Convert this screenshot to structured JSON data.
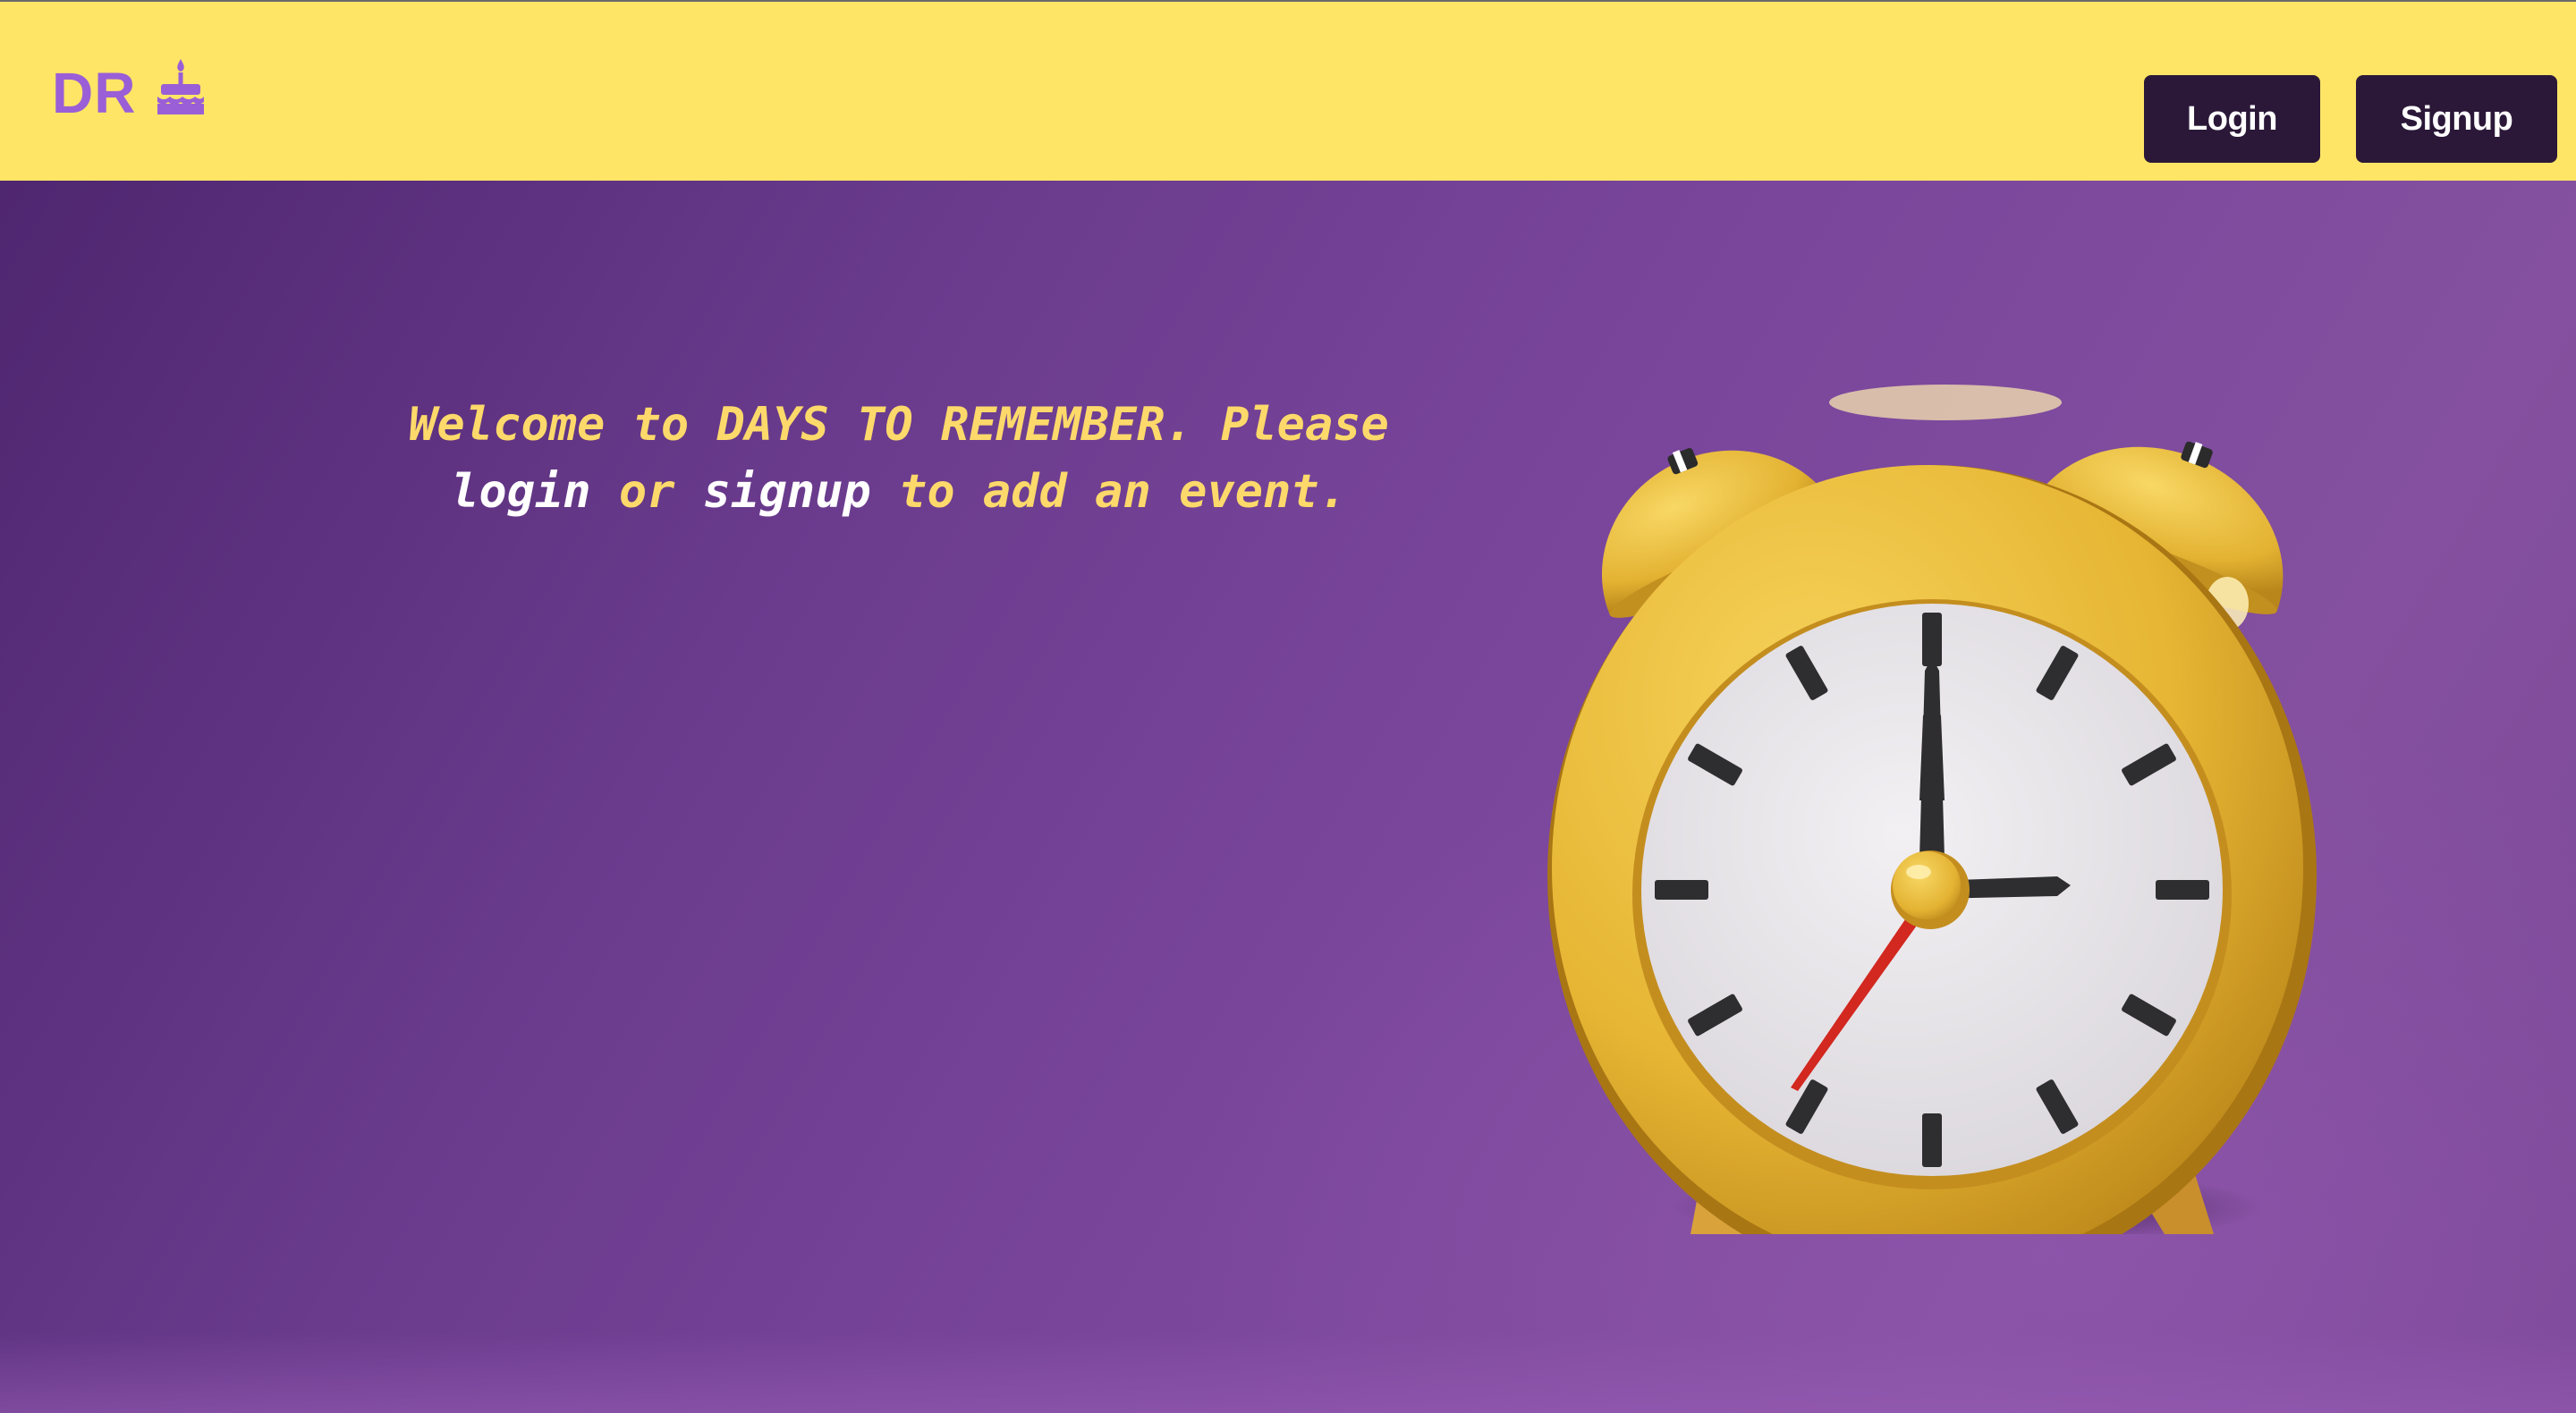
{
  "brand": {
    "text": "DR",
    "icon": "birthday-cake-icon",
    "color": "#9a5fd6"
  },
  "nav": {
    "login_label": "Login",
    "signup_label": "Signup",
    "background": "#fee566",
    "button_color": "#2b1839"
  },
  "hero": {
    "welcome_prefix": "Welcome to DAYS TO REMEMBER. Please",
    "login_link": "login",
    "or_text": " or ",
    "signup_link": "signup",
    "suffix": " to add an event.",
    "text_color": "#fcd96a",
    "link_color": "#ffffff",
    "image": "alarm-clock-illustration"
  }
}
